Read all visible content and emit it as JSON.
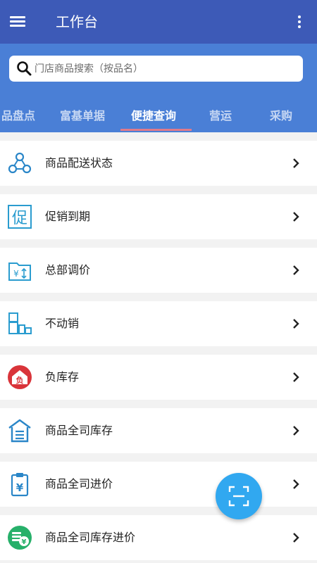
{
  "app_bar": {
    "title": "工作台",
    "menu_icon": "hamburger-menu-icon",
    "more_icon": "more-vertical-icon",
    "background_color": "#3d5ab7"
  },
  "search": {
    "icon": "search-icon",
    "placeholder": "门店商品搜索（按品名）",
    "value": ""
  },
  "tabs": [
    {
      "label": "品盘点",
      "active": false
    },
    {
      "label": "富基单据",
      "active": false
    },
    {
      "label": "便捷查询",
      "active": true
    },
    {
      "label": "营运",
      "active": false
    },
    {
      "label": "采购",
      "active": false
    }
  ],
  "tabs_background_color": "#4a7fd6",
  "tab_indicator_color": "#e07a8a",
  "list": {
    "items": [
      {
        "label": "商品配送状态",
        "icon": "delivery-network-icon"
      },
      {
        "label": "促销到期",
        "icon": "promotion-icon"
      },
      {
        "label": "总部调价",
        "icon": "price-adjust-folder-icon"
      },
      {
        "label": "不动销",
        "icon": "slow-moving-blocks-icon"
      },
      {
        "label": "负库存",
        "icon": "negative-stock-icon"
      },
      {
        "label": "商品全司库存",
        "icon": "warehouse-icon"
      },
      {
        "label": "商品全司进价",
        "icon": "purchase-price-clipboard-icon"
      },
      {
        "label": "商品全司库存进价",
        "icon": "stock-price-coins-icon"
      }
    ],
    "chevron_icon": "chevron-right-icon"
  },
  "fab": {
    "icon": "scan-icon",
    "color": "#31a8f0"
  }
}
